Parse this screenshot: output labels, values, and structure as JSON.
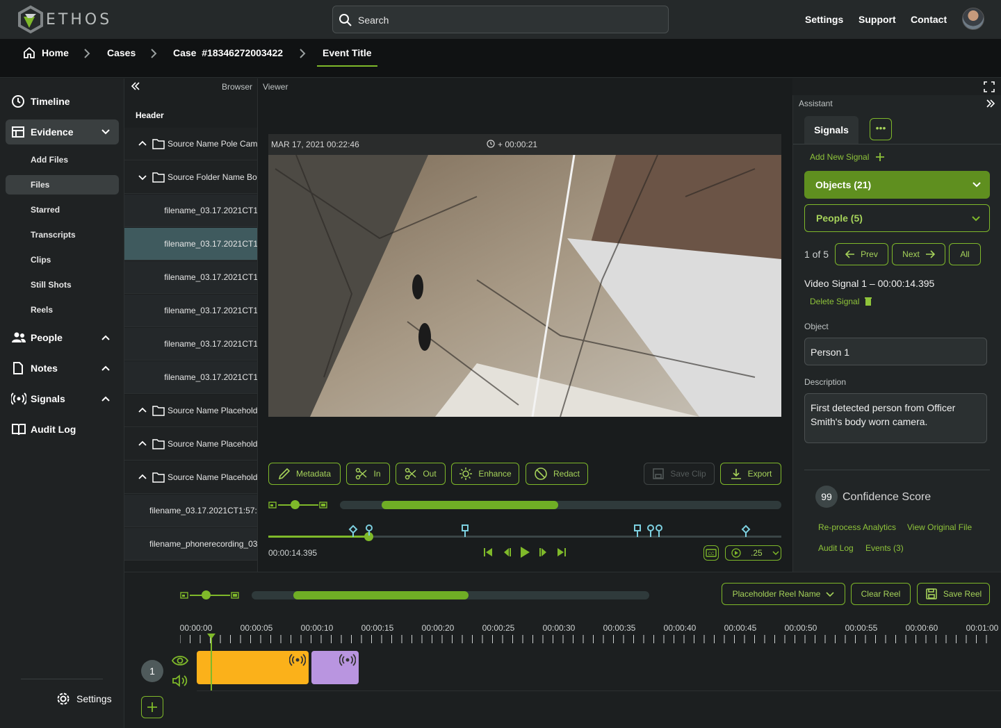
{
  "app": {
    "name": "ETHOS"
  },
  "topbar": {
    "search_placeholder": "Search",
    "links": [
      "Settings",
      "Support",
      "Contact"
    ]
  },
  "breadcrumb": {
    "items": [
      "Home",
      "Cases",
      "Case  #18346272003422",
      "Event Title"
    ]
  },
  "sidebar": {
    "items": [
      {
        "label": "Timeline",
        "icon": "clock-icon"
      },
      {
        "label": "Evidence",
        "icon": "film-icon"
      },
      {
        "label": "People",
        "icon": "people-icon"
      },
      {
        "label": "Notes",
        "icon": "document-icon"
      },
      {
        "label": "Signals",
        "icon": "broadcast-icon"
      },
      {
        "label": "Audit Log",
        "icon": "book-icon"
      }
    ],
    "evidence_sub": [
      "Add Files",
      "Files",
      "Starred",
      "Transcripts",
      "Clips",
      "Still Shots",
      "Reels"
    ],
    "settings": "Settings"
  },
  "browser": {
    "title": "Browser",
    "header": "Header",
    "rows": [
      {
        "label": "Source Name Pole Cam",
        "type": "folder",
        "expanded": false
      },
      {
        "label": "Source Folder Name Bo",
        "type": "folder",
        "expanded": true
      },
      {
        "label": "filename_03.17.2021CT1",
        "type": "file"
      },
      {
        "label": "filename_03.17.2021CT1",
        "type": "file",
        "selected": true
      },
      {
        "label": "filename_03.17.2021CT1",
        "type": "file"
      },
      {
        "label": "filename_03.17.2021CT1",
        "type": "file"
      },
      {
        "label": "filename_03.17.2021CT1",
        "type": "file"
      },
      {
        "label": "filename_03.17.2021CT1",
        "type": "file"
      },
      {
        "label": "Source Name Placehold",
        "type": "folder",
        "expanded": false
      },
      {
        "label": "Source Name Placehold",
        "type": "folder",
        "expanded": false
      },
      {
        "label": "Source Name Placehold",
        "type": "folder",
        "expanded": false
      },
      {
        "label": "filename_03.17.2021CT1:57:",
        "type": "file"
      },
      {
        "label": "filename_phonerecording_03",
        "type": "file"
      }
    ]
  },
  "viewer": {
    "title": "Viewer",
    "video_date": "MAR 17, 2021  00:22:46",
    "video_offset": "+ 00:00:21",
    "tools": [
      "Metadata",
      "In",
      "Out",
      "Enhance",
      "Redact"
    ],
    "save_clip": "Save Clip",
    "export": "Export",
    "current_time": "00:00:14.395",
    "speed": ".25",
    "zoom_bar_progress": 0.4
  },
  "assistant": {
    "title": "Assistant",
    "tab": "Signals",
    "more": "•••",
    "add_signal": "Add New Signal",
    "objects_dd": "Objects (21)",
    "people_dd": "People (5)",
    "pagination": "1 of 5",
    "prev": "Prev",
    "next": "Next",
    "all": "All",
    "signal_title": "Video Signal 1 – 00:00:14.395",
    "delete_signal": "Delete Signal",
    "object_label": "Object",
    "object_value": "Person 1",
    "description_label": "Description",
    "description_value": "First detected person from Officer Smith's body worn camera.",
    "confidence_value": "99",
    "confidence_label": "Confidence Score",
    "links": [
      "Re-process Analytics",
      "View Original File",
      "Audit Log",
      "Events (3)"
    ]
  },
  "reel": {
    "name": "Placeholder Reel Name",
    "clear": "Clear Reel",
    "save": "Save Reel",
    "track_number": "1",
    "ticks": [
      "00:00:00",
      "00:00:05",
      "00:00:10",
      "00:00:15",
      "00:00:20",
      "00:00:25",
      "00:00:30",
      "00:00:35",
      "00:00:40",
      "00:00:45",
      "00:00:50",
      "00:00:55",
      "00:00:60",
      "00:01:00"
    ],
    "zoom_bar_progress": 0.44
  },
  "colors": {
    "accent": "#7fb92a",
    "accent_fill": "#5f8f1f",
    "clip_yellow": "#fbb11a",
    "clip_purple": "#b995e0"
  }
}
